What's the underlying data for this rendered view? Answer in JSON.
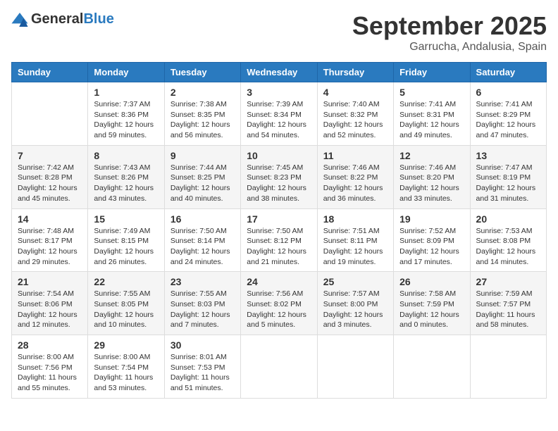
{
  "logo": {
    "text_general": "General",
    "text_blue": "Blue"
  },
  "header": {
    "month_title": "September 2025",
    "subtitle": "Garrucha, Andalusia, Spain"
  },
  "columns": [
    "Sunday",
    "Monday",
    "Tuesday",
    "Wednesday",
    "Thursday",
    "Friday",
    "Saturday"
  ],
  "weeks": [
    [
      {
        "day": "",
        "info": ""
      },
      {
        "day": "1",
        "info": "Sunrise: 7:37 AM\nSunset: 8:36 PM\nDaylight: 12 hours and 59 minutes."
      },
      {
        "day": "2",
        "info": "Sunrise: 7:38 AM\nSunset: 8:35 PM\nDaylight: 12 hours and 56 minutes."
      },
      {
        "day": "3",
        "info": "Sunrise: 7:39 AM\nSunset: 8:34 PM\nDaylight: 12 hours and 54 minutes."
      },
      {
        "day": "4",
        "info": "Sunrise: 7:40 AM\nSunset: 8:32 PM\nDaylight: 12 hours and 52 minutes."
      },
      {
        "day": "5",
        "info": "Sunrise: 7:41 AM\nSunset: 8:31 PM\nDaylight: 12 hours and 49 minutes."
      },
      {
        "day": "6",
        "info": "Sunrise: 7:41 AM\nSunset: 8:29 PM\nDaylight: 12 hours and 47 minutes."
      }
    ],
    [
      {
        "day": "7",
        "info": "Sunrise: 7:42 AM\nSunset: 8:28 PM\nDaylight: 12 hours and 45 minutes."
      },
      {
        "day": "8",
        "info": "Sunrise: 7:43 AM\nSunset: 8:26 PM\nDaylight: 12 hours and 43 minutes."
      },
      {
        "day": "9",
        "info": "Sunrise: 7:44 AM\nSunset: 8:25 PM\nDaylight: 12 hours and 40 minutes."
      },
      {
        "day": "10",
        "info": "Sunrise: 7:45 AM\nSunset: 8:23 PM\nDaylight: 12 hours and 38 minutes."
      },
      {
        "day": "11",
        "info": "Sunrise: 7:46 AM\nSunset: 8:22 PM\nDaylight: 12 hours and 36 minutes."
      },
      {
        "day": "12",
        "info": "Sunrise: 7:46 AM\nSunset: 8:20 PM\nDaylight: 12 hours and 33 minutes."
      },
      {
        "day": "13",
        "info": "Sunrise: 7:47 AM\nSunset: 8:19 PM\nDaylight: 12 hours and 31 minutes."
      }
    ],
    [
      {
        "day": "14",
        "info": "Sunrise: 7:48 AM\nSunset: 8:17 PM\nDaylight: 12 hours and 29 minutes."
      },
      {
        "day": "15",
        "info": "Sunrise: 7:49 AM\nSunset: 8:15 PM\nDaylight: 12 hours and 26 minutes."
      },
      {
        "day": "16",
        "info": "Sunrise: 7:50 AM\nSunset: 8:14 PM\nDaylight: 12 hours and 24 minutes."
      },
      {
        "day": "17",
        "info": "Sunrise: 7:50 AM\nSunset: 8:12 PM\nDaylight: 12 hours and 21 minutes."
      },
      {
        "day": "18",
        "info": "Sunrise: 7:51 AM\nSunset: 8:11 PM\nDaylight: 12 hours and 19 minutes."
      },
      {
        "day": "19",
        "info": "Sunrise: 7:52 AM\nSunset: 8:09 PM\nDaylight: 12 hours and 17 minutes."
      },
      {
        "day": "20",
        "info": "Sunrise: 7:53 AM\nSunset: 8:08 PM\nDaylight: 12 hours and 14 minutes."
      }
    ],
    [
      {
        "day": "21",
        "info": "Sunrise: 7:54 AM\nSunset: 8:06 PM\nDaylight: 12 hours and 12 minutes."
      },
      {
        "day": "22",
        "info": "Sunrise: 7:55 AM\nSunset: 8:05 PM\nDaylight: 12 hours and 10 minutes."
      },
      {
        "day": "23",
        "info": "Sunrise: 7:55 AM\nSunset: 8:03 PM\nDaylight: 12 hours and 7 minutes."
      },
      {
        "day": "24",
        "info": "Sunrise: 7:56 AM\nSunset: 8:02 PM\nDaylight: 12 hours and 5 minutes."
      },
      {
        "day": "25",
        "info": "Sunrise: 7:57 AM\nSunset: 8:00 PM\nDaylight: 12 hours and 3 minutes."
      },
      {
        "day": "26",
        "info": "Sunrise: 7:58 AM\nSunset: 7:59 PM\nDaylight: 12 hours and 0 minutes."
      },
      {
        "day": "27",
        "info": "Sunrise: 7:59 AM\nSunset: 7:57 PM\nDaylight: 11 hours and 58 minutes."
      }
    ],
    [
      {
        "day": "28",
        "info": "Sunrise: 8:00 AM\nSunset: 7:56 PM\nDaylight: 11 hours and 55 minutes."
      },
      {
        "day": "29",
        "info": "Sunrise: 8:00 AM\nSunset: 7:54 PM\nDaylight: 11 hours and 53 minutes."
      },
      {
        "day": "30",
        "info": "Sunrise: 8:01 AM\nSunset: 7:53 PM\nDaylight: 11 hours and 51 minutes."
      },
      {
        "day": "",
        "info": ""
      },
      {
        "day": "",
        "info": ""
      },
      {
        "day": "",
        "info": ""
      },
      {
        "day": "",
        "info": ""
      }
    ]
  ]
}
